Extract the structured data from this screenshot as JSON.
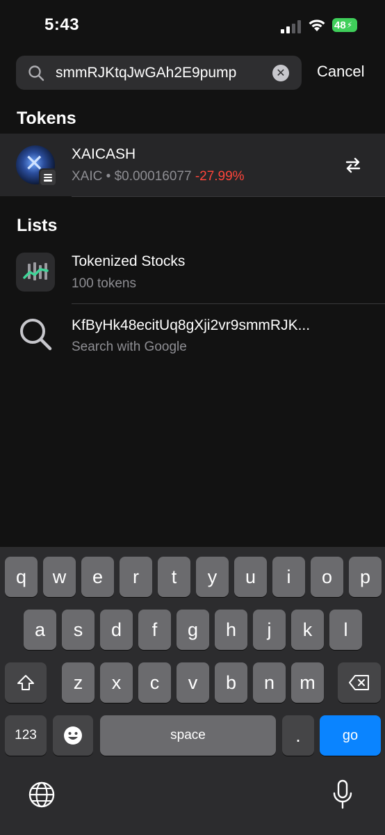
{
  "status": {
    "time": "5:43",
    "battery": "48"
  },
  "search": {
    "value": "smmRJKtqJwGAh2E9pump",
    "cancel_label": "Cancel"
  },
  "sections": {
    "tokens_title": "Tokens",
    "lists_title": "Lists"
  },
  "token": {
    "name": "XAICASH",
    "symbol": "XAIC",
    "separator": "•",
    "price": "$0.00016077",
    "change": "-27.99%",
    "change_color": "#ff453a"
  },
  "lists": [
    {
      "title": "Tokenized Stocks",
      "subtitle": "100 tokens",
      "icon": "chart-icon"
    }
  ],
  "web_search": {
    "title": "KfByHk48ecitUq8gXji2vr9smmRJK...",
    "subtitle": "Search with Google",
    "icon": "search-icon"
  },
  "keyboard": {
    "row1": [
      "q",
      "w",
      "e",
      "r",
      "t",
      "y",
      "u",
      "i",
      "o",
      "p"
    ],
    "row2": [
      "a",
      "s",
      "d",
      "f",
      "g",
      "h",
      "j",
      "k",
      "l"
    ],
    "row3": [
      "z",
      "x",
      "c",
      "v",
      "b",
      "n",
      "m"
    ],
    "num_label": "123",
    "space_label": "space",
    "period_label": ".",
    "go_label": "go"
  },
  "colors": {
    "accent": "#0a84ff",
    "negative": "#ff453a",
    "battery": "#3fcf5a"
  }
}
